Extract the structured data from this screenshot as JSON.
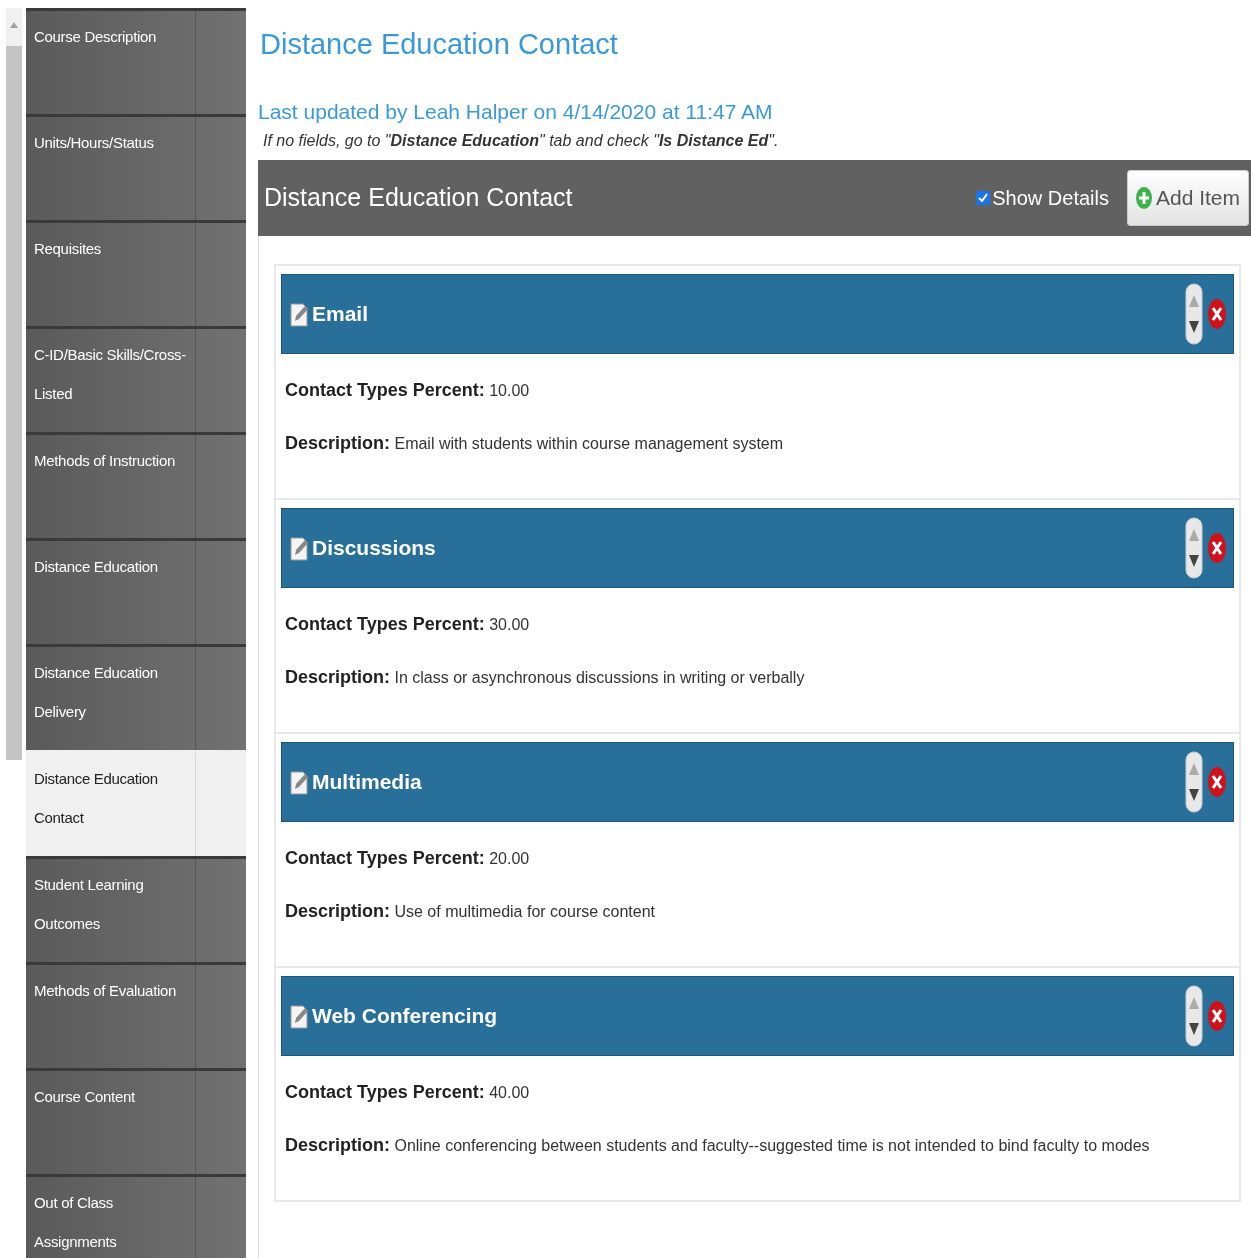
{
  "sidebar": {
    "items": [
      {
        "label": "Course Description",
        "selected": false
      },
      {
        "label": "Units/Hours/Status",
        "selected": false
      },
      {
        "label": "Requisites",
        "selected": false
      },
      {
        "label": "C-ID/Basic Skills/Cross-Listed",
        "selected": false
      },
      {
        "label": "Methods of Instruction",
        "selected": false
      },
      {
        "label": "Distance Education",
        "selected": false
      },
      {
        "label": "Distance Education Delivery",
        "selected": false
      },
      {
        "label": "Distance Education Contact",
        "selected": true
      },
      {
        "label": "Student Learning Outcomes",
        "selected": false
      },
      {
        "label": "Methods of Evaluation",
        "selected": false
      },
      {
        "label": "Course Content",
        "selected": false
      },
      {
        "label": "Out of Class Assignments",
        "selected": false
      }
    ]
  },
  "page_title": "Distance Education Contact",
  "last_updated": "Last updated by Leah Halper on 4/14/2020 at 11:47 AM",
  "note": "If no fields, go to \"**Distance Education**\" tab and check \"**Is Distance Ed**\".",
  "section": {
    "title": "Distance Education Contact",
    "show_details": {
      "label": "Show Details",
      "checked": true
    },
    "add_button": "Add Item",
    "items": [
      {
        "title": "Email",
        "fields": [
          {
            "label": "Contact Types Percent:",
            "value": "10.00"
          },
          {
            "label": "Description:",
            "value": "Email with students within course management system"
          }
        ]
      },
      {
        "title": "Discussions",
        "fields": [
          {
            "label": "Contact Types Percent:",
            "value": "30.00"
          },
          {
            "label": "Description:",
            "value": "In class or asynchronous discussions in writing or verbally"
          }
        ]
      },
      {
        "title": "Multimedia",
        "fields": [
          {
            "label": "Contact Types Percent:",
            "value": "20.00"
          },
          {
            "label": "Description:",
            "value": "Use of multimedia for course content"
          }
        ]
      },
      {
        "title": "Web Conferencing",
        "fields": [
          {
            "label": "Contact Types Percent:",
            "value": "40.00"
          },
          {
            "label": "Description:",
            "value": "Online conferencing between students and faculty--suggested time is not intended to bind faculty to modes"
          }
        ]
      }
    ]
  }
}
